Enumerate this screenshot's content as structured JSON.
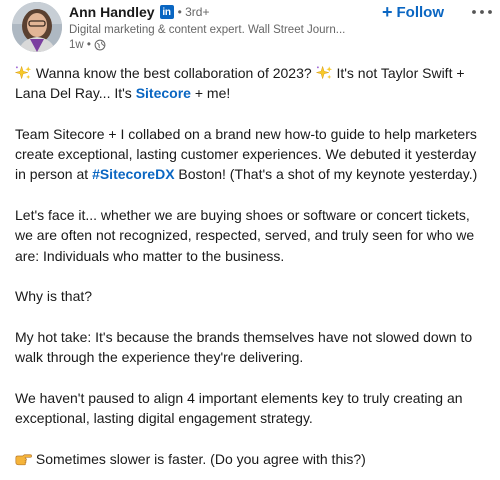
{
  "author": {
    "name": "Ann Handley",
    "badge_text": "in",
    "connection": "• 3rd+",
    "headline": "Digital marketing & content expert. Wall Street Journ...",
    "time": "1w •"
  },
  "actions": {
    "follow_plus": "+",
    "follow_label": "Follow"
  },
  "post": {
    "p1": {
      "t1": " Wanna know the best collaboration of 2023? ",
      "t2": " It's not Taylor Swift + Lana Del Ray... It's ",
      "link": "Sitecore",
      "t3": " + me!"
    },
    "p2": {
      "t1": "Team Sitecore + I collabed on a brand new how-to guide to help marketers create exceptional, lasting customer experiences. We debuted it yesterday in person at ",
      "hashtag": "#SitecoreDX",
      "t2": " Boston! (That's a shot of my keynote yesterday.)"
    },
    "p3": "Let's face it... whether we are buying shoes or software or concert tickets, we are often not recognized, respected, served, and truly seen for who we are: Individuals who matter to the business.",
    "p4": "Why is that?",
    "p5": "My hot take: It's because the brands themselves have not slowed down to walk through the experience they're delivering.",
    "p6": "We haven't paused to align 4 important elements key to truly creating an exceptional, lasting digital engagement strategy.",
    "p7": " Sometimes slower is faster. (Do you agree with this?)"
  },
  "icons": {
    "sparkle": "sparkles-icon",
    "pointing": "backhand-index-pointing-right-icon",
    "globe": "globe-icon",
    "more": "ellipsis-icon",
    "linkedin": "linkedin-icon"
  },
  "colors": {
    "link_blue": "#0a66c2",
    "text": "#191919",
    "muted": "#666666",
    "sparkle_yellow": "#f7c928",
    "pointing_hand": "#f5b43a"
  }
}
